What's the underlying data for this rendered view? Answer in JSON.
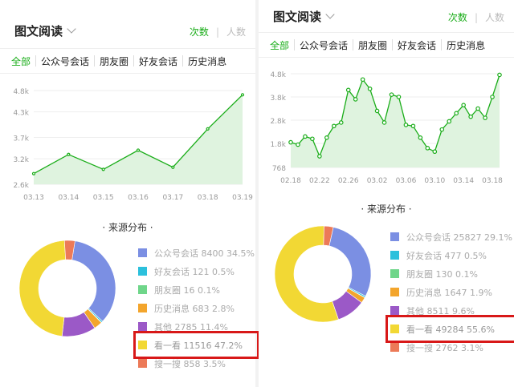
{
  "panels": [
    {
      "title": "图文阅读",
      "metric_active": "次数",
      "metric_sep": "|",
      "metric_inactive": "人数",
      "tabs": [
        "全部",
        "公众号会话",
        "朋友圈",
        "好友会话",
        "历史消息"
      ],
      "source_title": "· 来源分布 ·",
      "chart_data": {
        "type": "area",
        "categories": [
          "03.13",
          "03.14",
          "03.15",
          "03.16",
          "03.17",
          "03.18",
          "03.19"
        ],
        "series": [
          {
            "values": [
              2.85,
              3.3,
              2.95,
              3.4,
              3.0,
              3.9,
              4.7
            ]
          }
        ],
        "yticks": [
          "4.8k",
          "4.3k",
          "3.7k",
          "3.2k",
          "2.6k"
        ],
        "ytick_values": [
          4.8,
          4.3,
          3.7,
          3.2,
          2.6
        ],
        "ylim": [
          2.6,
          4.8
        ],
        "color": "#1aad19",
        "fill": "#dff3df"
      },
      "sources": [
        {
          "label": "公众号会话 8400 34.5%",
          "value": 34.5,
          "color": "#7b8fe3"
        },
        {
          "label": "好友会话 121 0.5%",
          "value": 0.5,
          "color": "#2cc0dc"
        },
        {
          "label": "朋友圈 16 0.1%",
          "value": 0.1,
          "color": "#6fd68a"
        },
        {
          "label": "历史消息 683 2.8%",
          "value": 2.8,
          "color": "#f3a52c"
        },
        {
          "label": "其他 2785 11.4%",
          "value": 11.4,
          "color": "#9b59c7"
        },
        {
          "label": "看一看 11516 47.2%",
          "value": 47.2,
          "color": "#f2d834",
          "highlight": true
        },
        {
          "label": "搜一搜 858 3.5%",
          "value": 3.5,
          "color": "#ec7a58"
        }
      ]
    },
    {
      "title": "图文阅读",
      "metric_active": "次数",
      "metric_sep": "|",
      "metric_inactive": "人数",
      "tabs": [
        "全部",
        "公众号会话",
        "朋友圈",
        "好友会话",
        "历史消息"
      ],
      "source_title": "· 来源分布 ·",
      "chart_data": {
        "type": "area",
        "categories": [
          "02.18",
          "02.19",
          "02.20",
          "02.21",
          "02.22",
          "02.23",
          "02.24",
          "02.25",
          "02.26",
          "02.27",
          "02.28",
          "03.01",
          "03.02",
          "03.03",
          "03.04",
          "03.05",
          "03.06",
          "03.07",
          "03.08",
          "03.09",
          "03.10",
          "03.11",
          "03.12",
          "03.13",
          "03.14",
          "03.15",
          "03.16",
          "03.17",
          "03.18",
          "03.19"
        ],
        "xtick_labels": [
          "02.18",
          "02.22",
          "02.26",
          "03.02",
          "03.06",
          "03.10",
          "03.14",
          "03.18"
        ],
        "series": [
          {
            "values": [
              1.85,
              1.75,
              2.1,
              2.0,
              1.25,
              2.05,
              2.55,
              2.7,
              4.1,
              3.7,
              4.55,
              4.15,
              3.2,
              2.7,
              3.9,
              3.8,
              2.6,
              2.55,
              2.05,
              1.6,
              1.45,
              2.4,
              2.75,
              3.1,
              3.45,
              2.95,
              3.3,
              2.9,
              3.8,
              4.75
            ]
          }
        ],
        "yticks": [
          "4.8k",
          "3.8k",
          "2.8k",
          "1.8k",
          "768"
        ],
        "ytick_values": [
          4.8,
          3.8,
          2.8,
          1.8,
          0.768
        ],
        "ylim": [
          0.768,
          4.8
        ],
        "color": "#1aad19",
        "fill": "#dff3df"
      },
      "sources": [
        {
          "label": "公众号会话 25827 29.1%",
          "value": 29.1,
          "color": "#7b8fe3"
        },
        {
          "label": "好友会话 477 0.5%",
          "value": 0.5,
          "color": "#2cc0dc"
        },
        {
          "label": "朋友圈 130 0.1%",
          "value": 0.1,
          "color": "#6fd68a"
        },
        {
          "label": "历史消息 1647 1.9%",
          "value": 1.9,
          "color": "#f3a52c"
        },
        {
          "label": "其他 8511 9.6%",
          "value": 9.6,
          "color": "#9b59c7"
        },
        {
          "label": "看一看 49284 55.6%",
          "value": 55.6,
          "color": "#f2d834",
          "highlight": true
        },
        {
          "label": "搜一搜 2762 3.1%",
          "value": 3.1,
          "color": "#ec7a58"
        }
      ]
    }
  ]
}
